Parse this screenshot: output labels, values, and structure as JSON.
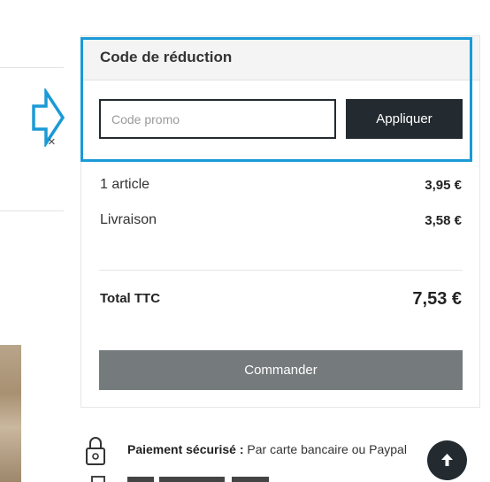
{
  "promo": {
    "title": "Code de réduction",
    "placeholder": "Code promo",
    "apply_label": "Appliquer"
  },
  "summary": {
    "rows": [
      {
        "label": "1 article",
        "value": "3,95 €"
      },
      {
        "label": "Livraison",
        "value": "3,58 €"
      }
    ],
    "total_label": "Total TTC",
    "total_value": "7,53 €",
    "order_label": "Commander"
  },
  "secure": {
    "title": "Paiement sécurisé :",
    "text": "Par carte bancaire ou Paypal"
  },
  "icons": [
    "close-icon",
    "arrow-right-icon",
    "padlock-icon",
    "arrow-up-icon"
  ],
  "colors": {
    "highlight": "#1a9ad6",
    "dark_button": "#232b30",
    "order_button": "#757a7c"
  }
}
